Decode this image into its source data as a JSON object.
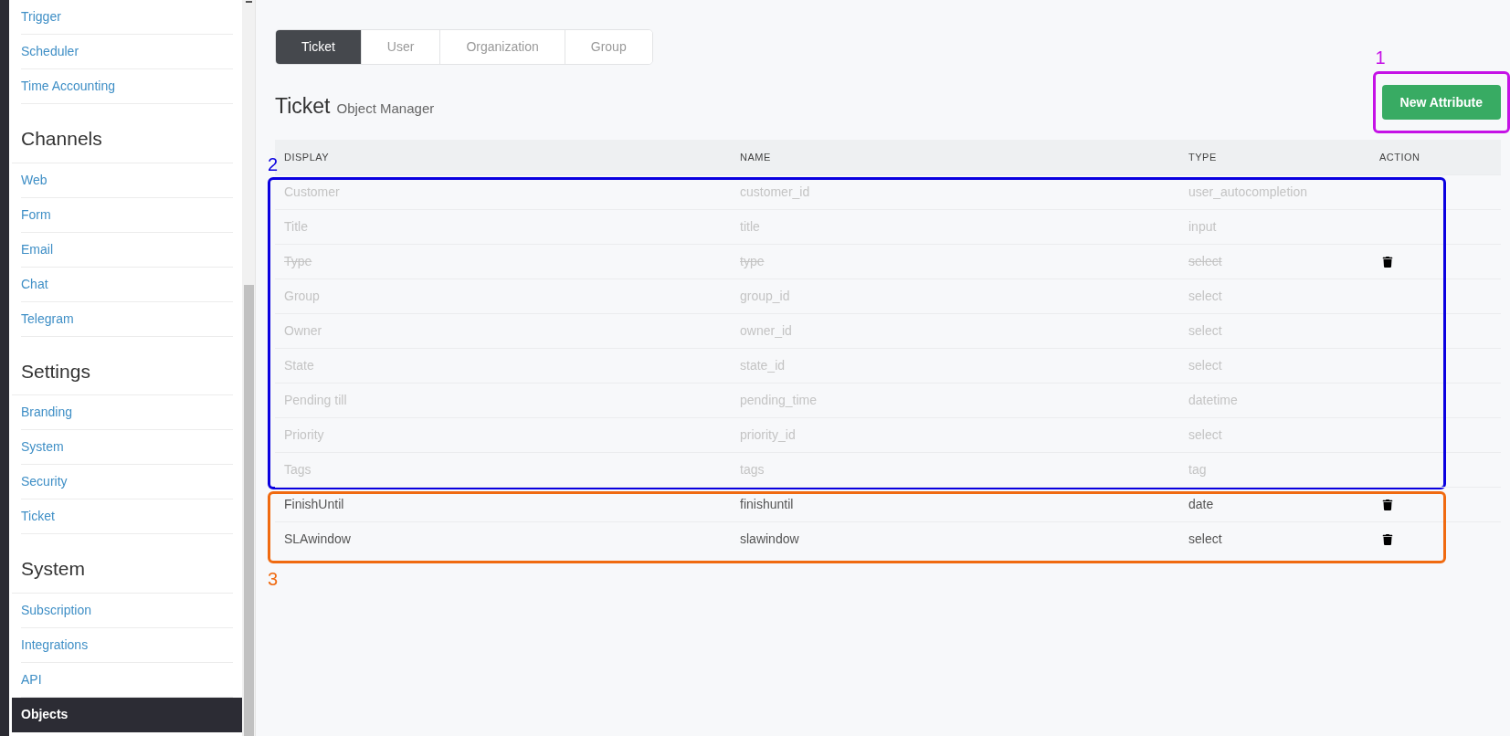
{
  "sidebar": {
    "sections": [
      {
        "items": [
          {
            "label": "Trigger",
            "selected": false
          },
          {
            "label": "Scheduler",
            "selected": false
          },
          {
            "label": "Time Accounting",
            "selected": false
          }
        ]
      },
      {
        "title": "Channels",
        "items": [
          {
            "label": "Web",
            "selected": false
          },
          {
            "label": "Form",
            "selected": false
          },
          {
            "label": "Email",
            "selected": false
          },
          {
            "label": "Chat",
            "selected": false
          },
          {
            "label": "Telegram",
            "selected": false
          }
        ]
      },
      {
        "title": "Settings",
        "items": [
          {
            "label": "Branding",
            "selected": false
          },
          {
            "label": "System",
            "selected": false
          },
          {
            "label": "Security",
            "selected": false
          },
          {
            "label": "Ticket",
            "selected": false
          }
        ]
      },
      {
        "title": "System",
        "items": [
          {
            "label": "Subscription",
            "selected": false
          },
          {
            "label": "Integrations",
            "selected": false
          },
          {
            "label": "API",
            "selected": false
          },
          {
            "label": "Objects",
            "selected": true
          }
        ]
      }
    ]
  },
  "tabs": [
    {
      "label": "Ticket",
      "selected": true
    },
    {
      "label": "User",
      "selected": false
    },
    {
      "label": "Organization",
      "selected": false
    },
    {
      "label": "Group",
      "selected": false
    }
  ],
  "header": {
    "title": "Ticket",
    "subtitle": "Object Manager"
  },
  "new_button": {
    "label": "New Attribute",
    "annotation": {
      "label": "1",
      "color": "#c512e6"
    }
  },
  "table": {
    "columns": [
      "DISPLAY",
      "NAME",
      "TYPE",
      "ACTION"
    ],
    "row_groups": [
      {
        "annotation": {
          "label": "2",
          "color": "#0a00e0"
        },
        "rows": [
          {
            "display": "Customer",
            "name": "customer_id",
            "type": "user_autocompletion",
            "editable": false,
            "deleted": false,
            "deletable": false
          },
          {
            "display": "Title",
            "name": "title",
            "type": "input",
            "editable": false,
            "deleted": false,
            "deletable": false
          },
          {
            "display": "Type",
            "name": "type",
            "type": "select",
            "editable": false,
            "deleted": true,
            "deletable": true
          },
          {
            "display": "Group",
            "name": "group_id",
            "type": "select",
            "editable": false,
            "deleted": false,
            "deletable": false
          },
          {
            "display": "Owner",
            "name": "owner_id",
            "type": "select",
            "editable": false,
            "deleted": false,
            "deletable": false
          },
          {
            "display": "State",
            "name": "state_id",
            "type": "select",
            "editable": false,
            "deleted": false,
            "deletable": false
          },
          {
            "display": "Pending till",
            "name": "pending_time",
            "type": "datetime",
            "editable": false,
            "deleted": false,
            "deletable": false
          },
          {
            "display": "Priority",
            "name": "priority_id",
            "type": "select",
            "editable": false,
            "deleted": false,
            "deletable": false
          },
          {
            "display": "Tags",
            "name": "tags",
            "type": "tag",
            "editable": false,
            "deleted": false,
            "deletable": false
          }
        ]
      },
      {
        "annotation": {
          "label": "3",
          "color": "#f06a10"
        },
        "rows": [
          {
            "display": "FinishUntil",
            "name": "finishuntil",
            "type": "date",
            "editable": true,
            "deleted": false,
            "deletable": true
          },
          {
            "display": "SLAwindow",
            "name": "slawindow",
            "type": "select",
            "editable": true,
            "deleted": false,
            "deletable": true
          }
        ]
      }
    ]
  }
}
